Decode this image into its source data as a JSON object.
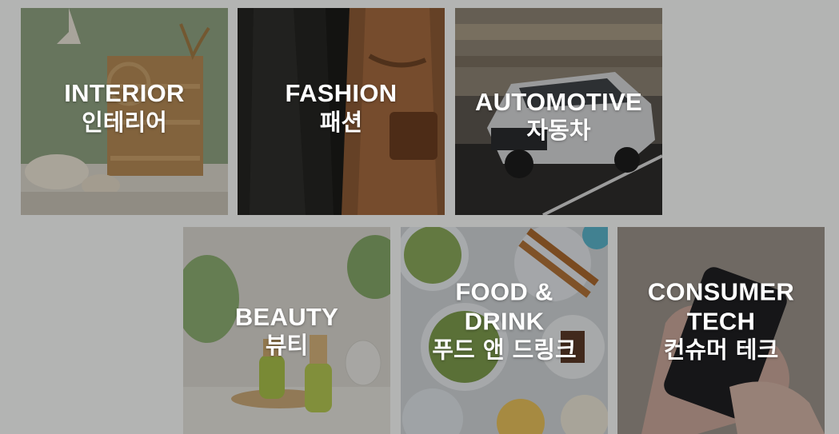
{
  "tiles": [
    {
      "id": "interior",
      "en": "INTERIOR",
      "ko": "인테리어"
    },
    {
      "id": "fashion",
      "en": "FASHION",
      "ko": "패션"
    },
    {
      "id": "automotive",
      "en": "AUTOMOTIVE",
      "ko": "자동차"
    },
    {
      "id": "beauty",
      "en": "BEAUTY",
      "ko": "뷰티"
    },
    {
      "id": "food",
      "en_line1": "FOOD &",
      "en_line2": "DRINK",
      "ko": "푸드 앤 드링크"
    },
    {
      "id": "tech",
      "en_line1": "CONSUMER",
      "en_line2": "TECH",
      "ko": "컨슈머 테크"
    }
  ],
  "colors": {
    "page_bg": "#b3b4b3",
    "label_text": "#ffffff"
  }
}
